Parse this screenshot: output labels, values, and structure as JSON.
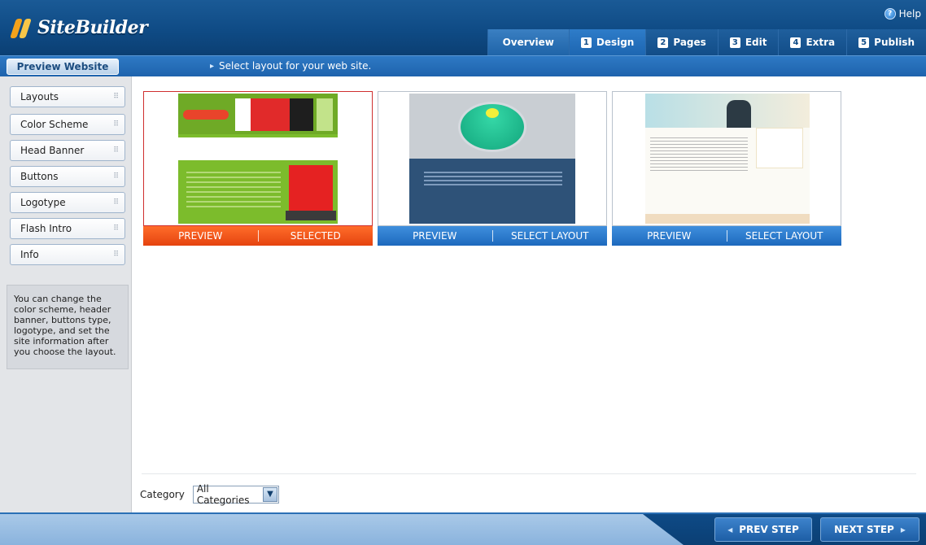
{
  "app": {
    "title": "SiteBuilder",
    "help_label": "Help"
  },
  "tabs": [
    {
      "label": "Overview",
      "num": ""
    },
    {
      "label": "Design",
      "num": "1"
    },
    {
      "label": "Pages",
      "num": "2"
    },
    {
      "label": "Edit",
      "num": "3"
    },
    {
      "label": "Extra",
      "num": "4"
    },
    {
      "label": "Publish",
      "num": "5"
    }
  ],
  "toolbar": {
    "preview_website": "Preview Website",
    "instruction": "Select layout for your web site."
  },
  "sidebar": {
    "items": [
      {
        "label": "Layouts"
      },
      {
        "label": "Color Scheme"
      },
      {
        "label": "Head Banner"
      },
      {
        "label": "Buttons"
      },
      {
        "label": "Logotype"
      },
      {
        "label": "Flash Intro"
      },
      {
        "label": "Info"
      }
    ],
    "info_text": "You can change the color scheme, header banner, buttons type, logotype, and set the site information after you choose the layout."
  },
  "layouts": [
    {
      "preview_label": "PREVIEW",
      "action_label": "SELECTED",
      "selected": true
    },
    {
      "preview_label": "PREVIEW",
      "action_label": "SELECT LAYOUT",
      "selected": false
    },
    {
      "preview_label": "PREVIEW",
      "action_label": "SELECT LAYOUT",
      "selected": false
    }
  ],
  "category": {
    "label": "Category",
    "selected": "All Categories"
  },
  "footer": {
    "prev_label": "PREV STEP",
    "next_label": "NEXT STEP"
  },
  "colors": {
    "header": "#0f4b85",
    "accent_blue": "#1d69bd",
    "selected_orange": "#e5430f"
  }
}
